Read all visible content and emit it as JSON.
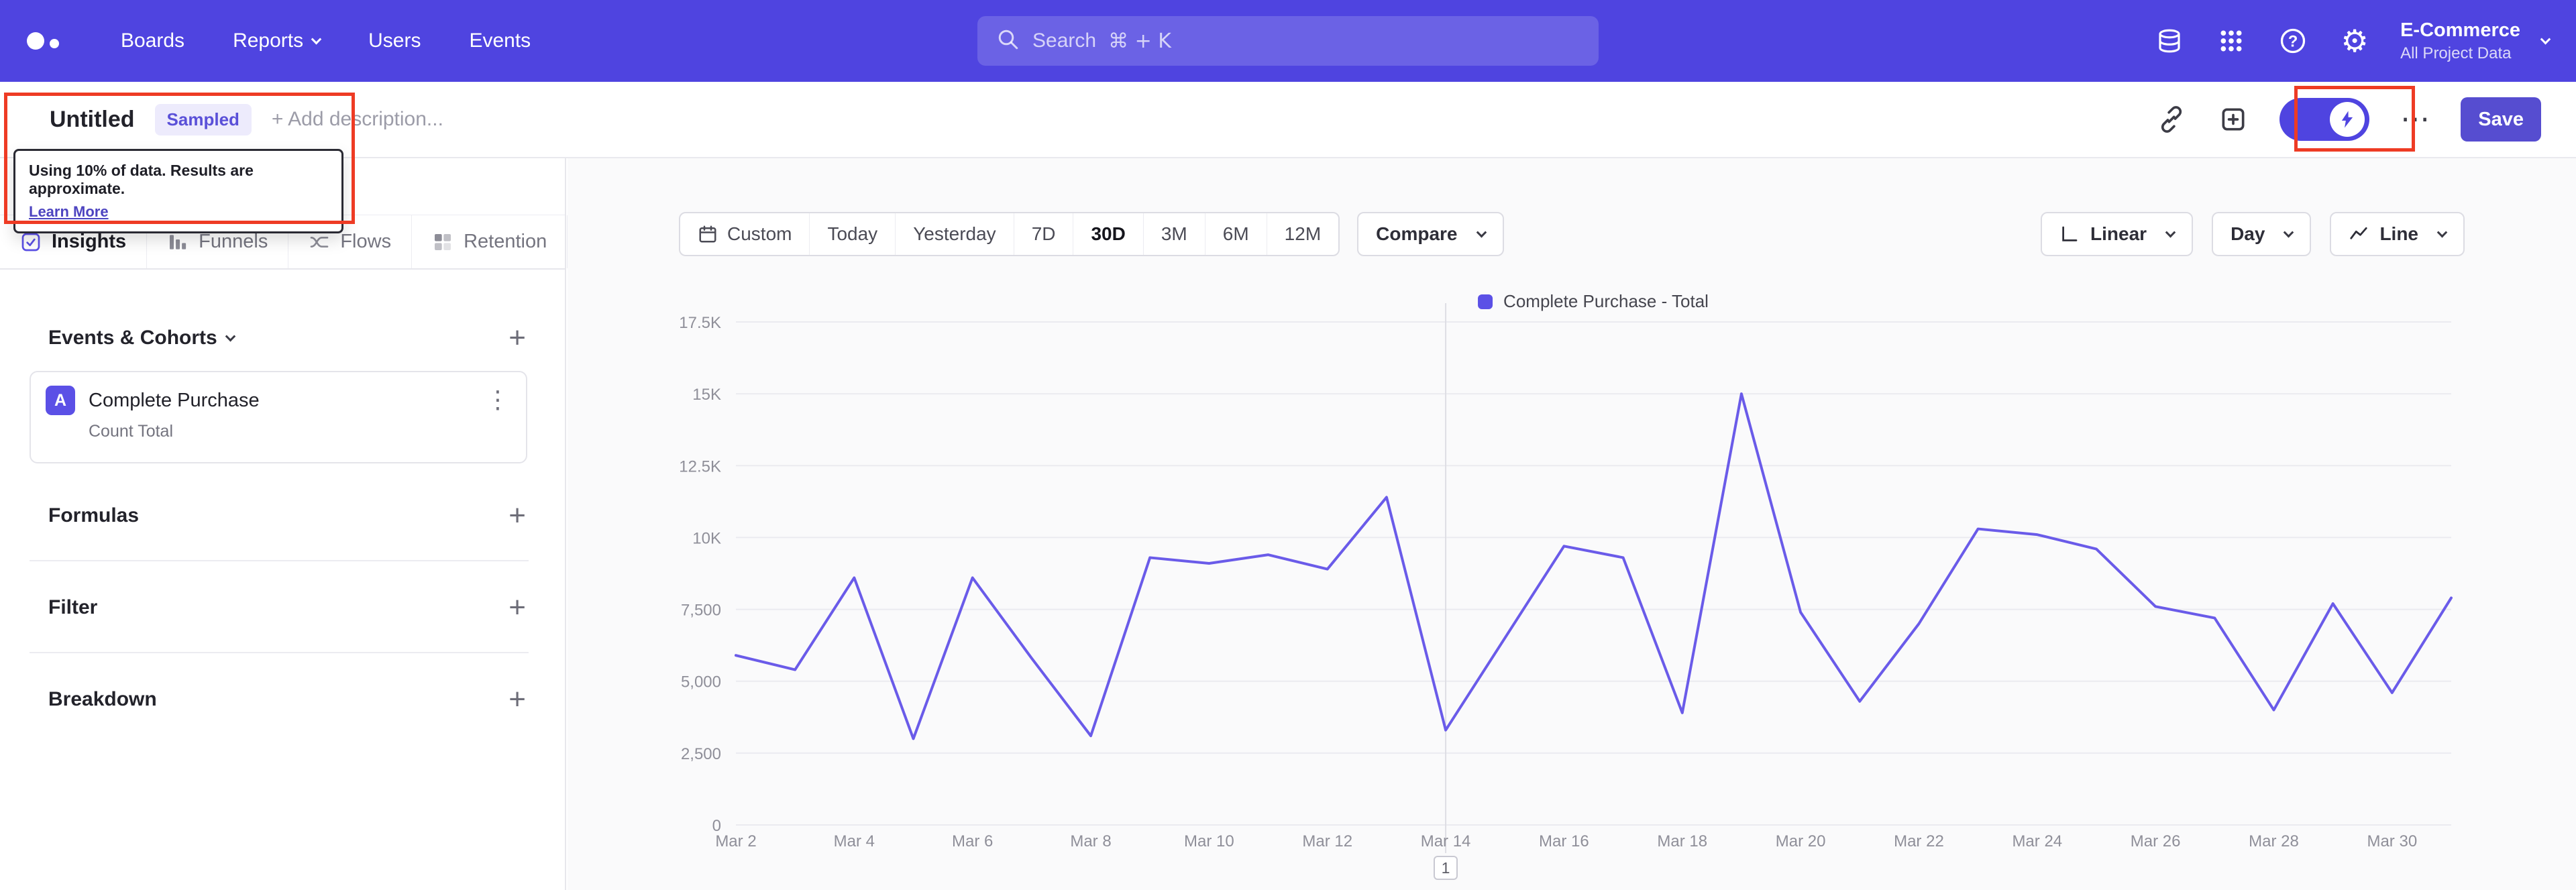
{
  "navbar": {
    "nav_items": [
      "Boards",
      "Reports",
      "Users",
      "Events"
    ],
    "search": {
      "placeholder": "Search",
      "shortcut": "⌘ + K"
    },
    "project_name": "E-Commerce",
    "project_scope": "All Project Data"
  },
  "toolbar": {
    "title": "Untitled",
    "sampled_badge": "Sampled",
    "add_description": "+ Add description...",
    "save_label": "Save",
    "tooltip_text": "Using 10% of data. Results are approximate.",
    "tooltip_link": "Learn More"
  },
  "sidebar": {
    "tabs": [
      {
        "label": "Insights"
      },
      {
        "label": "Funnels"
      },
      {
        "label": "Flows"
      },
      {
        "label": "Retention"
      }
    ],
    "events_header": "Events & Cohorts",
    "event_row": {
      "avatar": "A",
      "name": "Complete Purchase",
      "metric": "Count Total"
    },
    "formulas_header": "Formulas",
    "filter_header": "Filter",
    "breakdown_header": "Breakdown"
  },
  "controls": {
    "custom_label": "Custom",
    "ranges": [
      "Today",
      "Yesterday",
      "7D",
      "30D",
      "3M",
      "6M",
      "12M"
    ],
    "selected_range": "30D",
    "compare_label": "Compare",
    "scale_label": "Linear",
    "granularity_label": "Day",
    "chart_type_label": "Line"
  },
  "chart_data": {
    "type": "line",
    "legend": "Complete Purchase - Total",
    "categories": [
      "Mar 2",
      "Mar 3",
      "Mar 4",
      "Mar 5",
      "Mar 6",
      "Mar 7",
      "Mar 8",
      "Mar 9",
      "Mar 10",
      "Mar 11",
      "Mar 12",
      "Mar 13",
      "Mar 14",
      "Mar 15",
      "Mar 16",
      "Mar 17",
      "Mar 18",
      "Mar 19",
      "Mar 20",
      "Mar 21",
      "Mar 22",
      "Mar 23",
      "Mar 24",
      "Mar 25",
      "Mar 26",
      "Mar 27",
      "Mar 28",
      "Mar 29",
      "Mar 30",
      "Mar 31"
    ],
    "values": [
      5900,
      5400,
      8600,
      3000,
      8600,
      5800,
      3100,
      9300,
      9100,
      9400,
      8900,
      11400,
      3300,
      6500,
      9700,
      9300,
      3900,
      15000,
      7400,
      4300,
      7000,
      10300,
      10100,
      9600,
      7600,
      7200,
      4000,
      7700,
      4600,
      7900
    ],
    "y_ticks": [
      17500,
      15000,
      12500,
      10000,
      7500,
      5000,
      2500,
      0
    ],
    "y_tick_labels": [
      "17.5K",
      "15K",
      "12.5K",
      "10K",
      "7,500",
      "5,000",
      "2,500",
      "0"
    ],
    "ylim": [
      0,
      17500
    ],
    "x_label_step": 2,
    "grid": true,
    "legend_position": "top",
    "line_color": "#6a5be9",
    "annotation": {
      "category": "Mar 14",
      "badge": "1"
    }
  }
}
